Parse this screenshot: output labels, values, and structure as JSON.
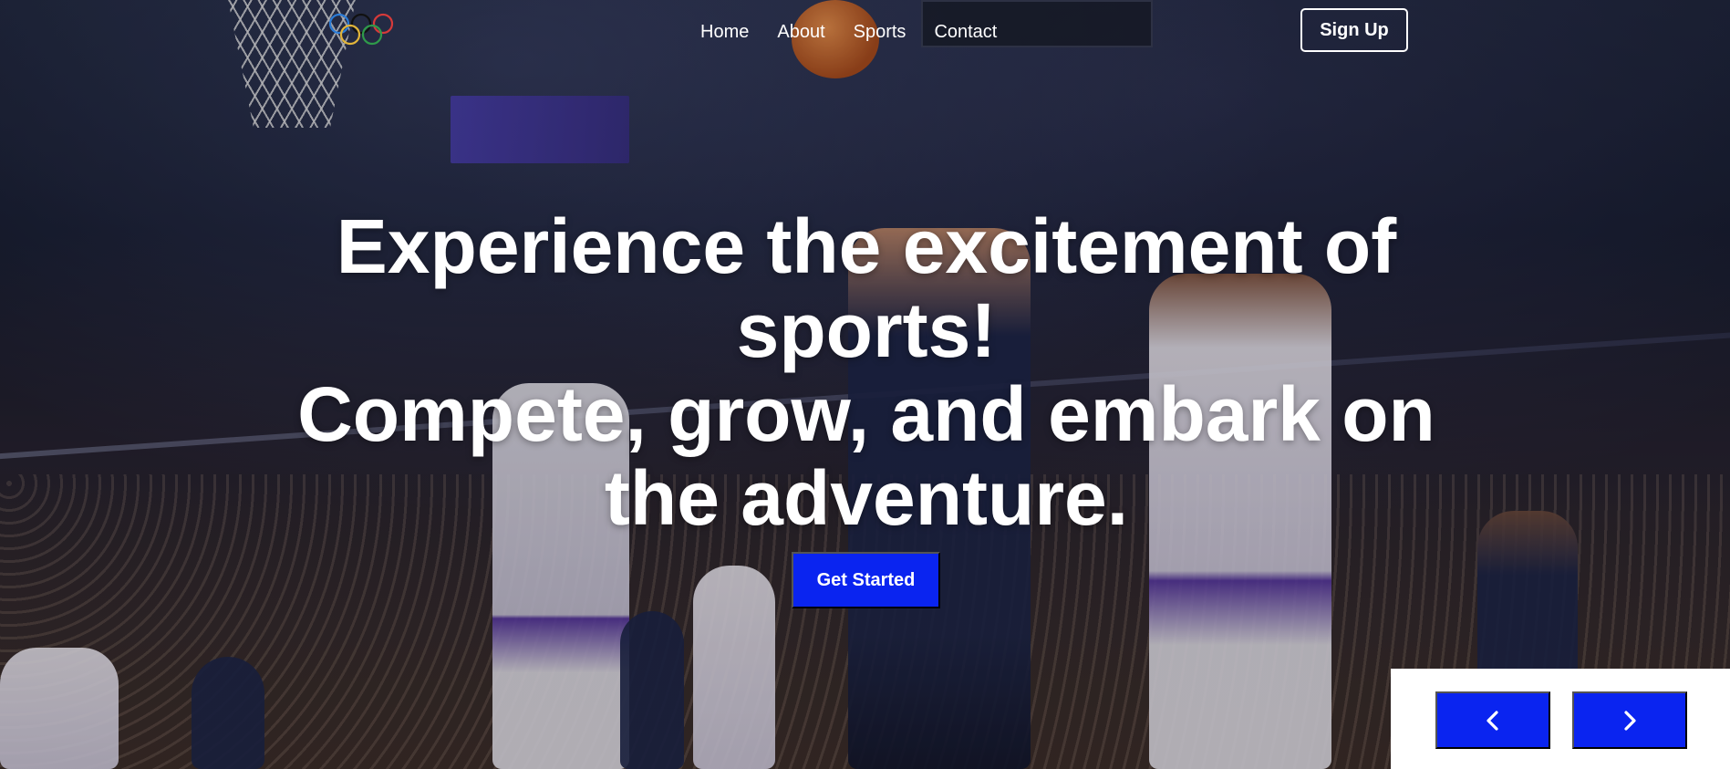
{
  "nav": {
    "logo": "olympic-rings-logo",
    "items": [
      {
        "label": "Home"
      },
      {
        "label": "About"
      },
      {
        "label": "Sports"
      },
      {
        "label": "Contact"
      }
    ],
    "signup_label": "Sign Up"
  },
  "hero": {
    "headline_line1": "Experience the excitement of",
    "headline_line2": "sports!",
    "headline_line3": "Compete, grow, and embark on",
    "headline_line4": "the adventure.",
    "cta_label": "Get Started"
  },
  "carousel": {
    "prev_icon": "chevron-left-icon",
    "next_icon": "chevron-right-icon"
  },
  "colors": {
    "accent": "#0a24f0",
    "text": "#ffffff"
  }
}
